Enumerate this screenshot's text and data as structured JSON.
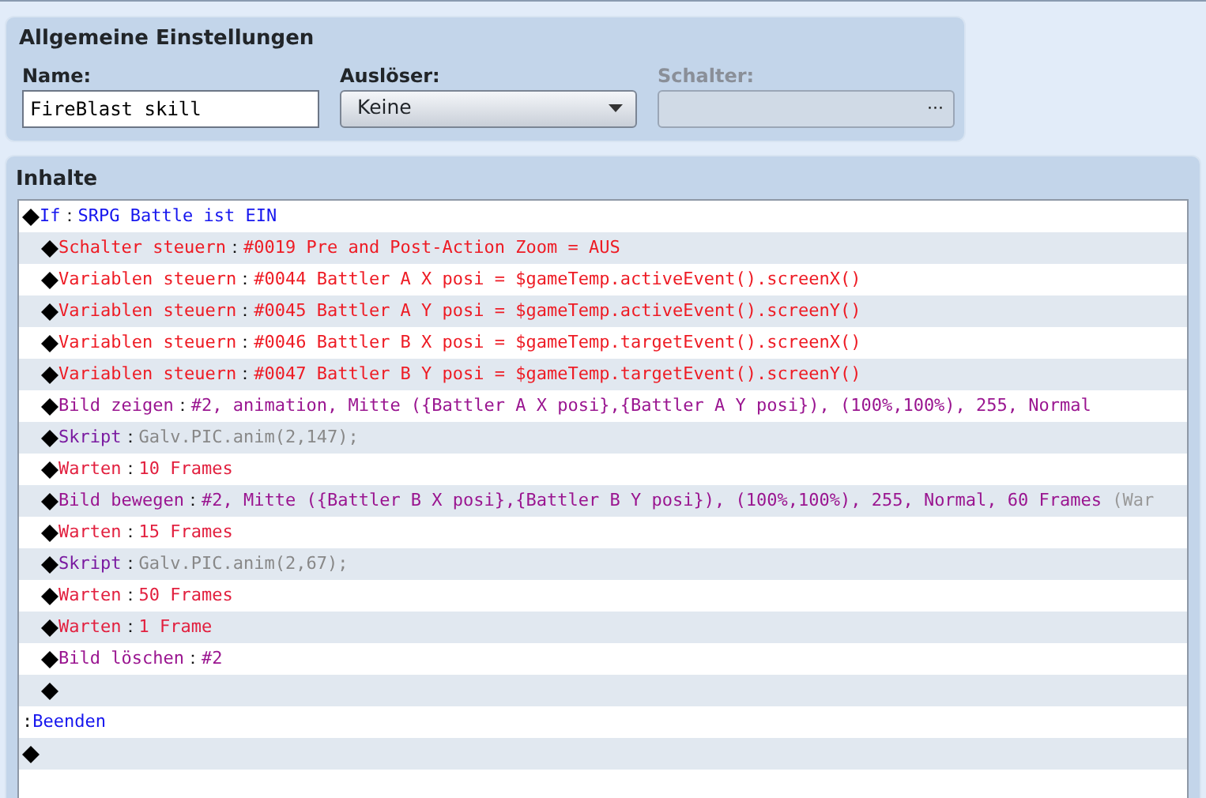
{
  "general_settings": {
    "title": "Allgemeine Einstellungen",
    "name_field": {
      "label": "Name:",
      "value": "FireBlast skill"
    },
    "trigger_field": {
      "label": "Auslöser:",
      "value": "Keine"
    },
    "switch_field": {
      "label": "Schalter:",
      "disabled": true,
      "button": "···"
    }
  },
  "contents": {
    "title": "Inhalte",
    "commands": [
      {
        "kind": "flow",
        "command": "If",
        "separator": "：",
        "params": "SRPG Battle ist EIN",
        "children": [
          {
            "kind": "control",
            "command": "Schalter steuern",
            "separator": "：",
            "params": "#0019 Pre and Post-Action Zoom  = AUS"
          },
          {
            "kind": "control",
            "command": "Variablen steuern",
            "separator": "：",
            "params": "#0044 Battler A X posi = $gameTemp.activeEvent().screenX()"
          },
          {
            "kind": "control",
            "command": "Variablen steuern",
            "separator": "：",
            "params": "#0045 Battler A Y posi = $gameTemp.activeEvent().screenY()"
          },
          {
            "kind": "control",
            "command": "Variablen steuern",
            "separator": "：",
            "params": "#0046 Battler B X posi = $gameTemp.targetEvent().screenX()"
          },
          {
            "kind": "control",
            "command": "Variablen steuern",
            "separator": "：",
            "params": "#0047 Battler B Y posi = $gameTemp.targetEvent().screenY()"
          },
          {
            "kind": "picture",
            "command": "Bild zeigen",
            "separator": "：",
            "params": "#2, animation, Mitte ({Battler A X posi},{Battler A Y posi}), (100%,100%), 255, Normal"
          },
          {
            "kind": "script",
            "command": "Skript",
            "separator": "：",
            "params": "Galv.PIC.anim(2,147);"
          },
          {
            "kind": "wait",
            "command": "Warten",
            "separator": "：",
            "params": "10 Frames"
          },
          {
            "kind": "picture",
            "command": "Bild bewegen",
            "separator": "：",
            "params": "#2, Mitte ({Battler B X posi},{Battler B Y posi}), (100%,100%), 255, Normal, 60 Frames",
            "note": "(War"
          },
          {
            "kind": "wait",
            "command": "Warten",
            "separator": "：",
            "params": "15 Frames"
          },
          {
            "kind": "script",
            "command": "Skript",
            "separator": "：",
            "params": "Galv.PIC.anim(2,67);"
          },
          {
            "kind": "wait",
            "command": "Warten",
            "separator": "：",
            "params": "50 Frames"
          },
          {
            "kind": "wait",
            "command": "Warten",
            "separator": "：",
            "params": "1 Frame"
          },
          {
            "kind": "picture",
            "command": "Bild löschen",
            "separator": "：",
            "params": "#2"
          },
          {
            "kind": "empty"
          }
        ]
      },
      {
        "kind": "branch_end",
        "separator": ":",
        "command": "Beenden"
      },
      {
        "kind": "empty"
      }
    ]
  }
}
